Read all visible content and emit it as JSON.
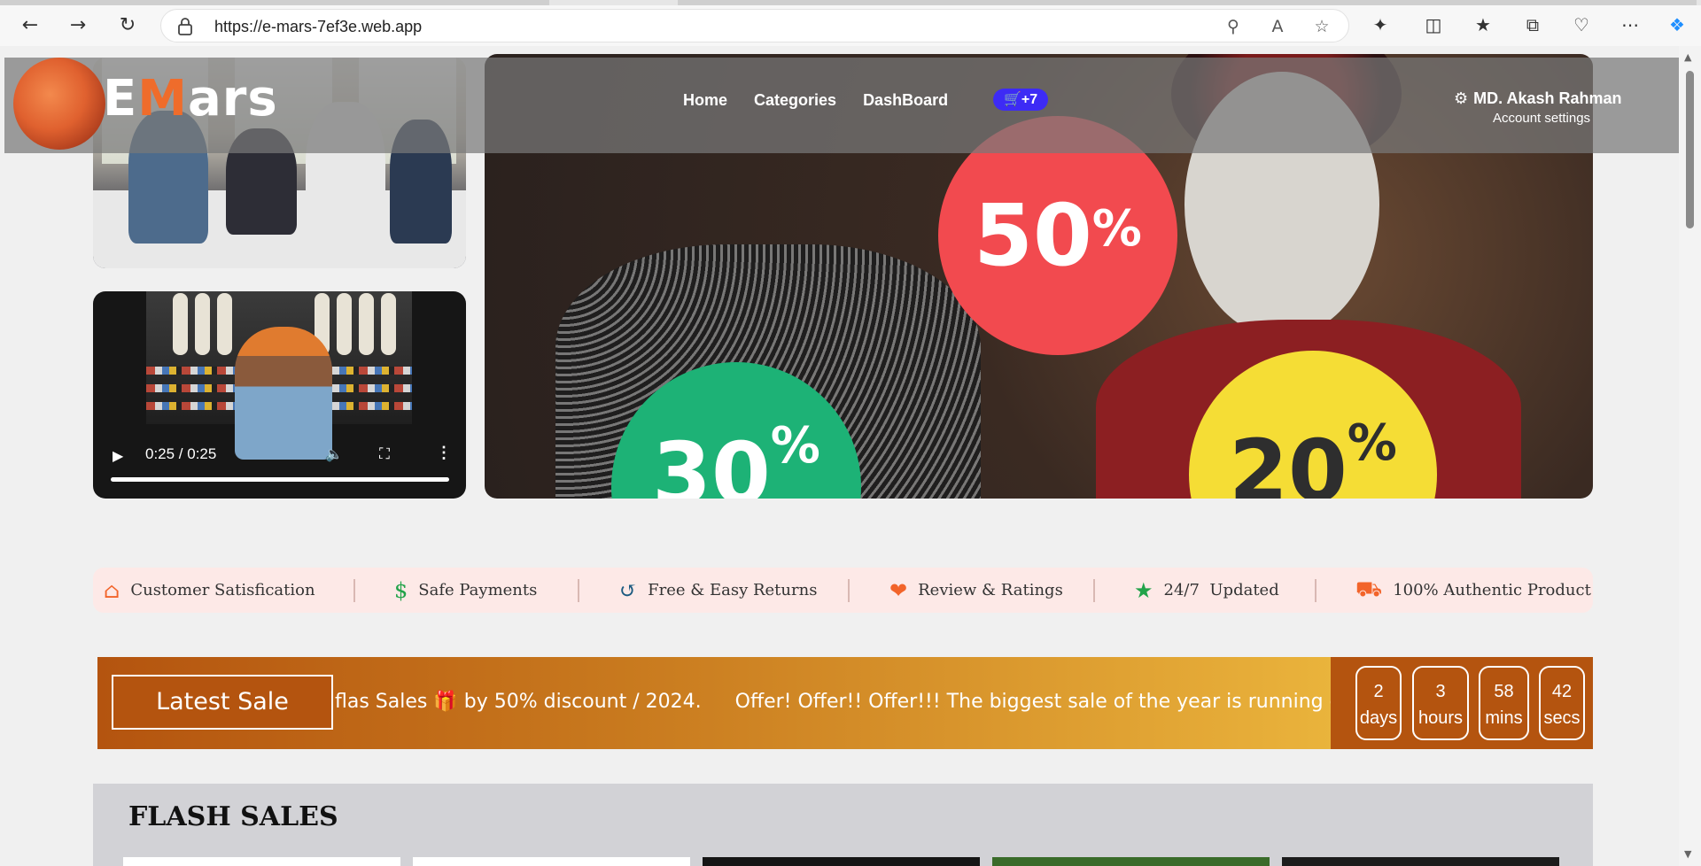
{
  "browser": {
    "url": "https://e-mars-7ef3e.web.app"
  },
  "nav": {
    "logo_first": "E",
    "logo_m": "M",
    "logo_rest": "ars",
    "links": [
      "Home",
      "Categories",
      "DashBoard"
    ],
    "cart_count": "+7",
    "user_name": "MD. Akash Rahman",
    "account_settings": "Account settings"
  },
  "video": {
    "time": "0:25 / 0:25",
    "progress": 1.0
  },
  "hero": {
    "badge_50": "50",
    "badge_30": "30",
    "badge_20": "20",
    "percent": "%"
  },
  "features": [
    {
      "label": "Customer Satisfication",
      "icon": "house-check-icon",
      "color": "#f2642a"
    },
    {
      "label": "Safe Payments",
      "icon": "money-hand-icon",
      "color": "#22a34a"
    },
    {
      "label": "Free & Easy Returns",
      "icon": "rotate-left-icon",
      "color": "#1b5a80"
    },
    {
      "label": "Review & Ratings",
      "icon": "heart-circle-icon",
      "color": "#f2642a"
    },
    {
      "label": "24/7  Updated",
      "icon": "handshake-icon",
      "color": "#22a34a"
    },
    {
      "label": "100% Authentic Product",
      "icon": "truck-icon",
      "color": "#f2642a"
    }
  ],
  "sale": {
    "latest": "Latest Sale",
    "marquee_a": "flas Sales",
    "marquee_b": "by 50% discount / 2024.",
    "marquee_c": "Offer! Offer!! Offer!!! The biggest sale of the year is running on t",
    "timer": [
      {
        "value": "2",
        "unit": "days"
      },
      {
        "value": "3",
        "unit": "hours"
      },
      {
        "value": "58",
        "unit": "mins"
      },
      {
        "value": "42",
        "unit": "secs"
      }
    ]
  },
  "flash": {
    "title": "FLASH SALES"
  },
  "colors": {
    "accent": "#ef6c2b",
    "cart": "#3d2bf5",
    "sale_dark": "#b4540f"
  }
}
